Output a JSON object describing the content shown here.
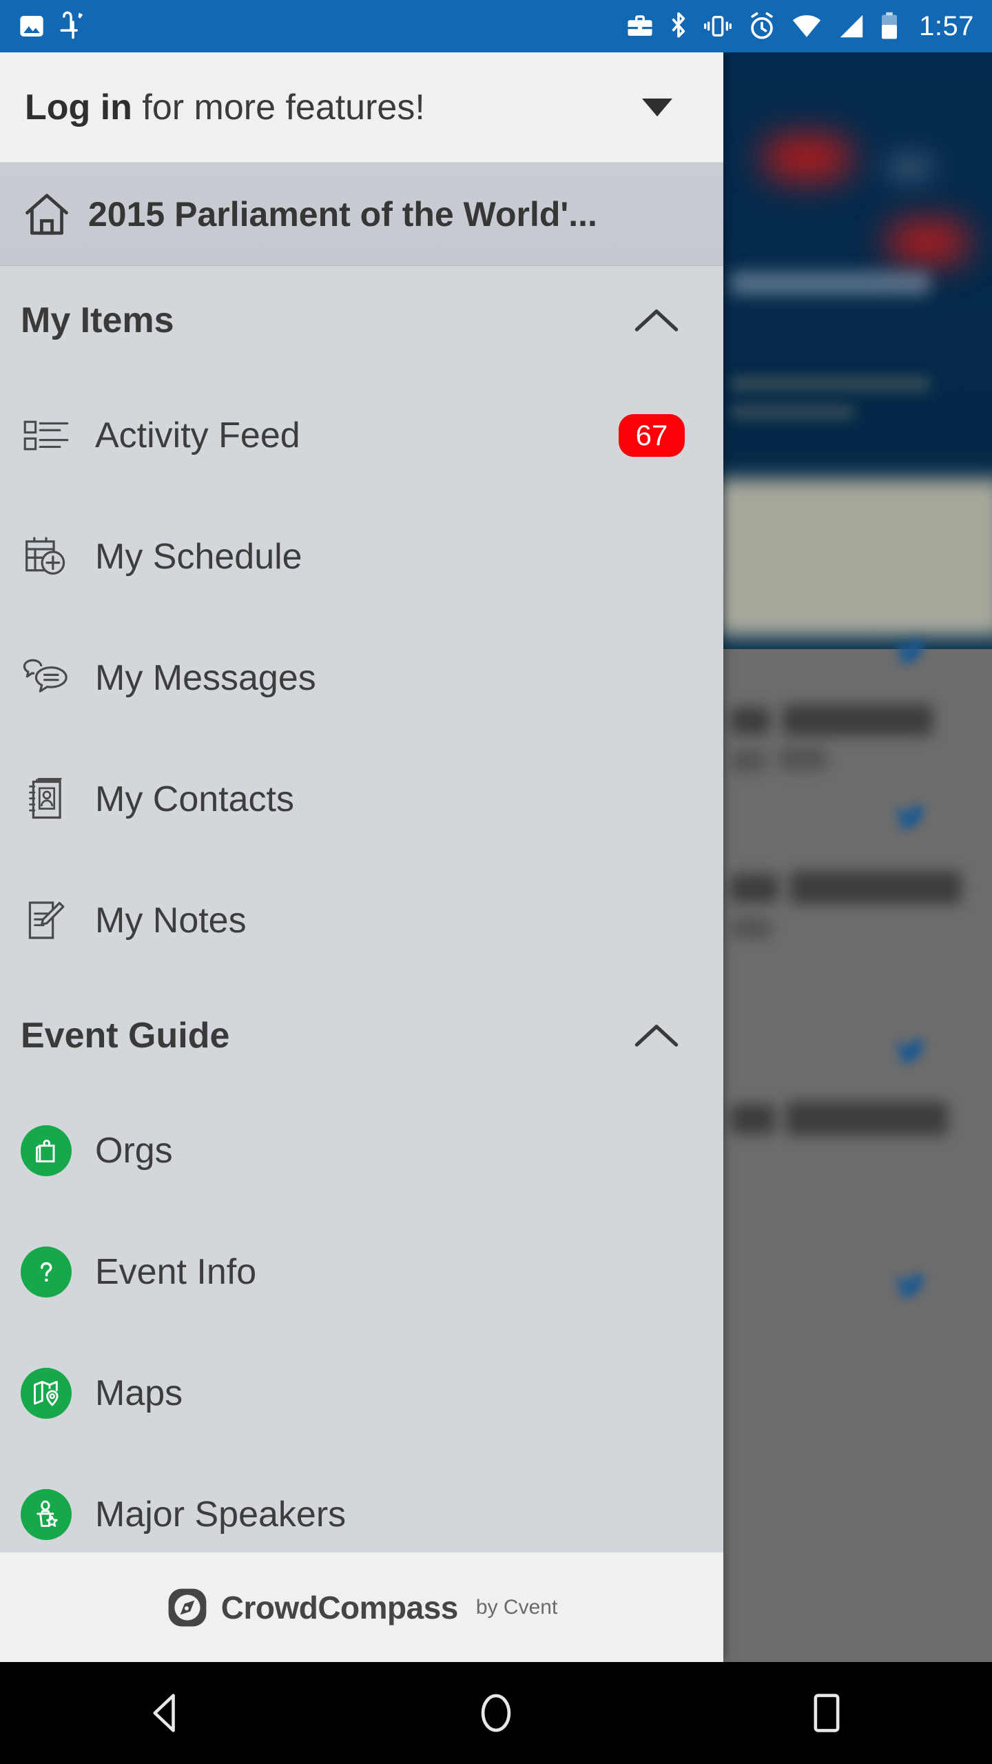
{
  "status_bar": {
    "background_color": "#1268b3",
    "left_icons": [
      "image-icon",
      "jupiter-glyph-icon"
    ],
    "right_icons": [
      "briefcase-icon",
      "bluetooth-icon",
      "vibrate-icon",
      "alarm-icon",
      "wifi-icon",
      "signal-icon",
      "battery-icon"
    ],
    "time": "1:57"
  },
  "drawer": {
    "login": {
      "bold_text": "Log in",
      "rest_text": " for more features!",
      "expand_icon": "chevron-down-icon"
    },
    "event": {
      "home_icon": "home-icon",
      "title": "2015 Parliament of the World'..."
    },
    "sections": [
      {
        "title": "My Items",
        "collapse_icon": "chevron-up-icon",
        "items": [
          {
            "label": "Activity Feed",
            "icon": "list-icon",
            "badge": "67"
          },
          {
            "label": "My Schedule",
            "icon": "calendar-add-icon",
            "badge": ""
          },
          {
            "label": "My Messages",
            "icon": "chat-bubbles-icon",
            "badge": ""
          },
          {
            "label": "My Contacts",
            "icon": "address-book-icon",
            "badge": ""
          },
          {
            "label": "My Notes",
            "icon": "note-pencil-icon",
            "badge": ""
          }
        ]
      },
      {
        "title": "Event Guide",
        "collapse_icon": "chevron-up-icon",
        "items": [
          {
            "label": "Orgs",
            "icon": "shopping-bag-icon",
            "badge": ""
          },
          {
            "label": "Event Info",
            "icon": "question-mark-icon",
            "badge": ""
          },
          {
            "label": "Maps",
            "icon": "map-pin-icon",
            "badge": ""
          },
          {
            "label": "Major Speakers",
            "icon": "speaker-podium-icon",
            "badge": ""
          }
        ]
      }
    ],
    "footer": {
      "logo_icon": "compass-icon",
      "brand": "CrowdCompass",
      "by_line": "by Cvent"
    }
  },
  "nav_bar": {
    "back": "back-triangle-icon",
    "home": "home-circle-icon",
    "recents": "recents-square-icon"
  },
  "colors": {
    "status_bar": "#1268b3",
    "badge_red": "#fb0007",
    "accent_green": "#16a84b",
    "drawer_bg": "#d3d6da",
    "header_bg": "#eff0f0"
  }
}
